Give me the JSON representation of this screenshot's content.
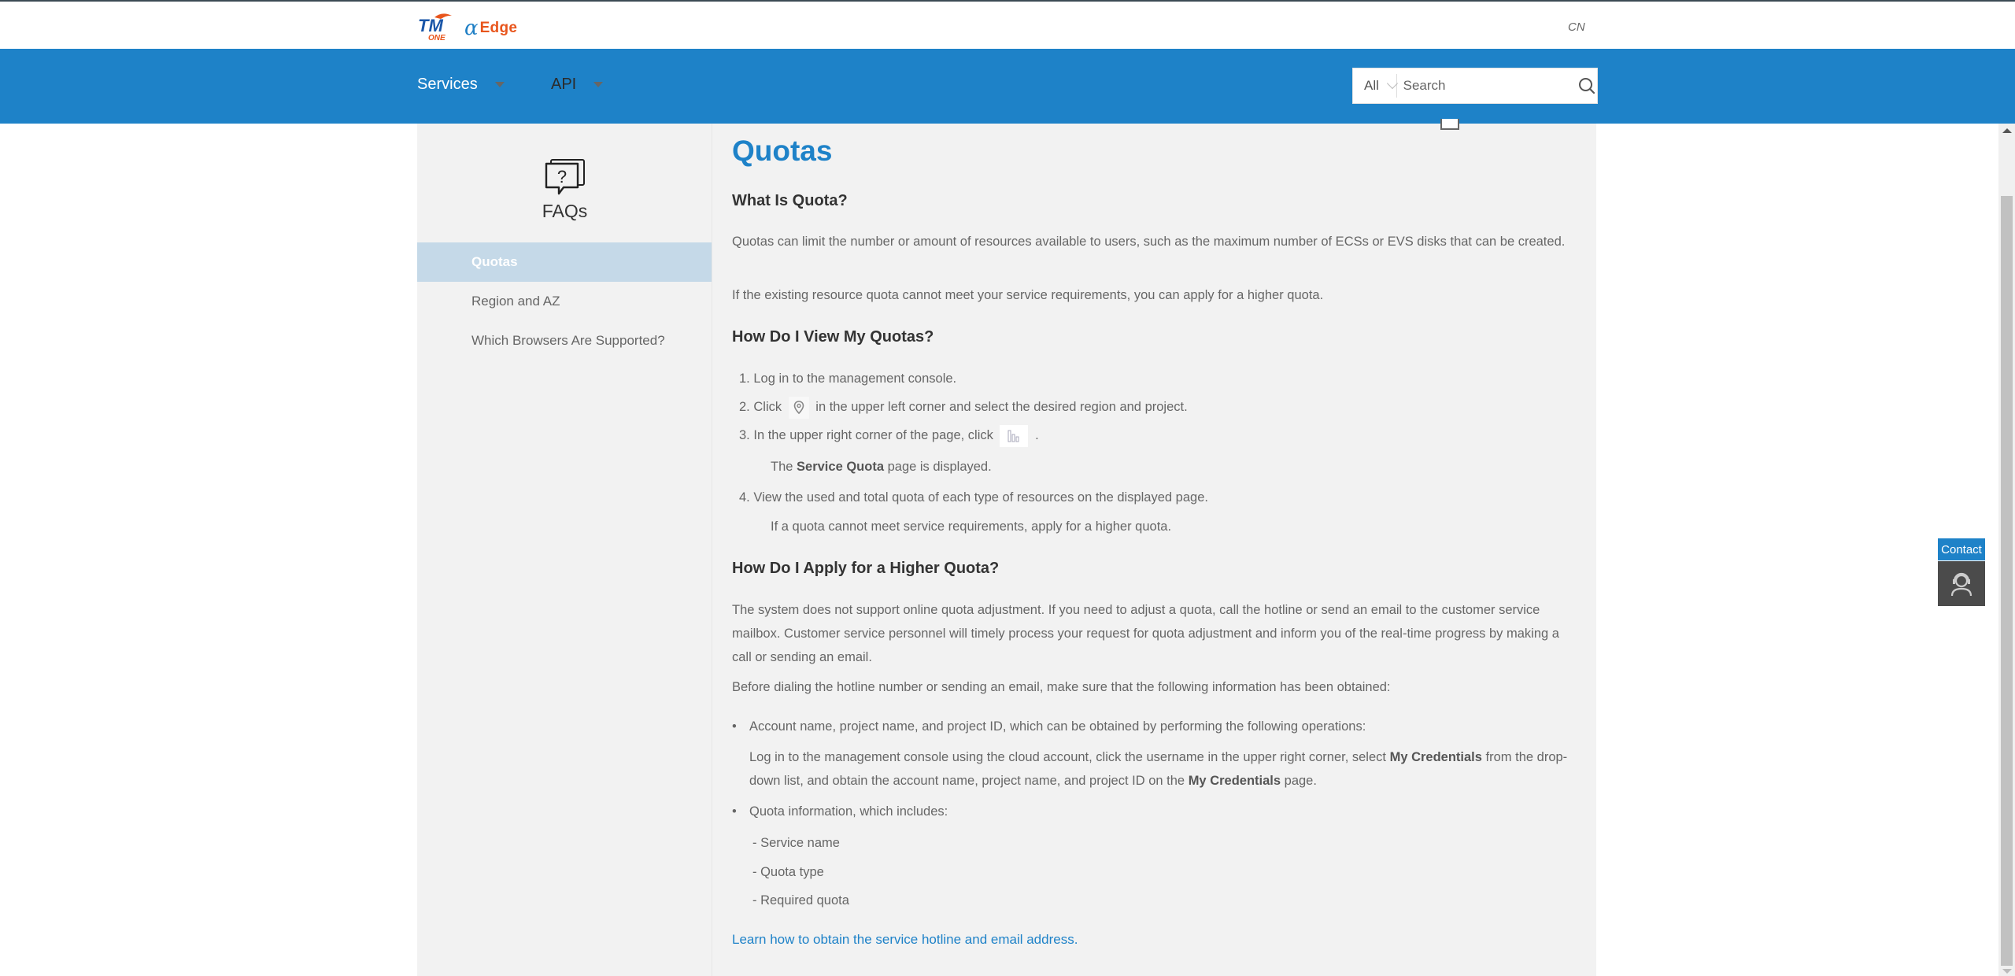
{
  "header": {
    "logo_primary": "TM ONE",
    "logo_secondary": "αEdge",
    "logo_secondary_alpha": "α",
    "logo_secondary_word": "Edge",
    "language": "CN",
    "nav": [
      {
        "label": "Services"
      },
      {
        "label": "API"
      }
    ],
    "search": {
      "scope": "All",
      "placeholder": "Search",
      "value": ""
    }
  },
  "sidebar": {
    "title": "FAQs",
    "items": [
      {
        "label": "Quotas",
        "active": true
      },
      {
        "label": "Region and AZ",
        "active": false
      },
      {
        "label": "Which Browsers Are Supported?",
        "active": false
      }
    ]
  },
  "article": {
    "title": "Quotas",
    "sections": [
      {
        "heading": "What Is Quota?",
        "paragraphs": [
          "Quotas can limit the number or amount of resources available to users, such as the maximum number of ECSs or EVS disks that can be created.",
          "If the existing resource quota cannot meet your service requirements, you can apply for a higher quota."
        ]
      },
      {
        "heading": "How Do I View My Quotas?",
        "steps": [
          {
            "num": "1.",
            "text": "Log in to the management console."
          },
          {
            "num": "2.",
            "before": "Click",
            "after": "in the upper left corner and select the desired region and project.",
            "icon": "location-pin-icon"
          },
          {
            "num": "3.",
            "before": "In the upper right corner of the page, click",
            "after": ".",
            "icon": "quota-bars-icon",
            "note_pre": "The",
            "note_bold": "Service Quota",
            "note_post": "page is displayed."
          },
          {
            "num": "4.",
            "text": "View the used and total quota of each type of resources on the displayed page.",
            "note": "If a quota cannot meet service requirements, apply for a higher quota."
          }
        ]
      },
      {
        "heading": "How Do I Apply for a Higher Quota?",
        "paragraphs": [
          "The system does not support online quota adjustment. If you need to adjust a quota, call the hotline or send an email to the customer service mailbox. Customer service personnel will timely process your request for quota adjustment and inform you of the real-time progress by making a call or sending an email.",
          "Before dialing the hotline number or sending an email, make sure that the following information has been obtained:"
        ],
        "bullets": [
          {
            "text": "Account name, project name, and project ID, which can be obtained by performing the following operations:",
            "detail_1": "Log in to the management console using the cloud account, click the username in the upper right corner, select",
            "detail_bold_1": "My Credentials",
            "detail_2": "from the drop-down list, and obtain the account name, project name, and project ID on the",
            "detail_bold_2": "My Credentials",
            "detail_3": "page."
          },
          {
            "text": "Quota information, which includes:",
            "subitems": [
              "- Service name",
              "- Quota type",
              "- Required quota"
            ]
          }
        ],
        "link": "Learn how to obtain the service hotline and email address."
      }
    ]
  },
  "contact": {
    "label": "Contact"
  },
  "colors": {
    "brand_blue": "#1e82c8",
    "sidebar_active": "#c5d9e8",
    "content_bg": "#f2f2f2",
    "contact_dark": "#4b4b4b"
  }
}
